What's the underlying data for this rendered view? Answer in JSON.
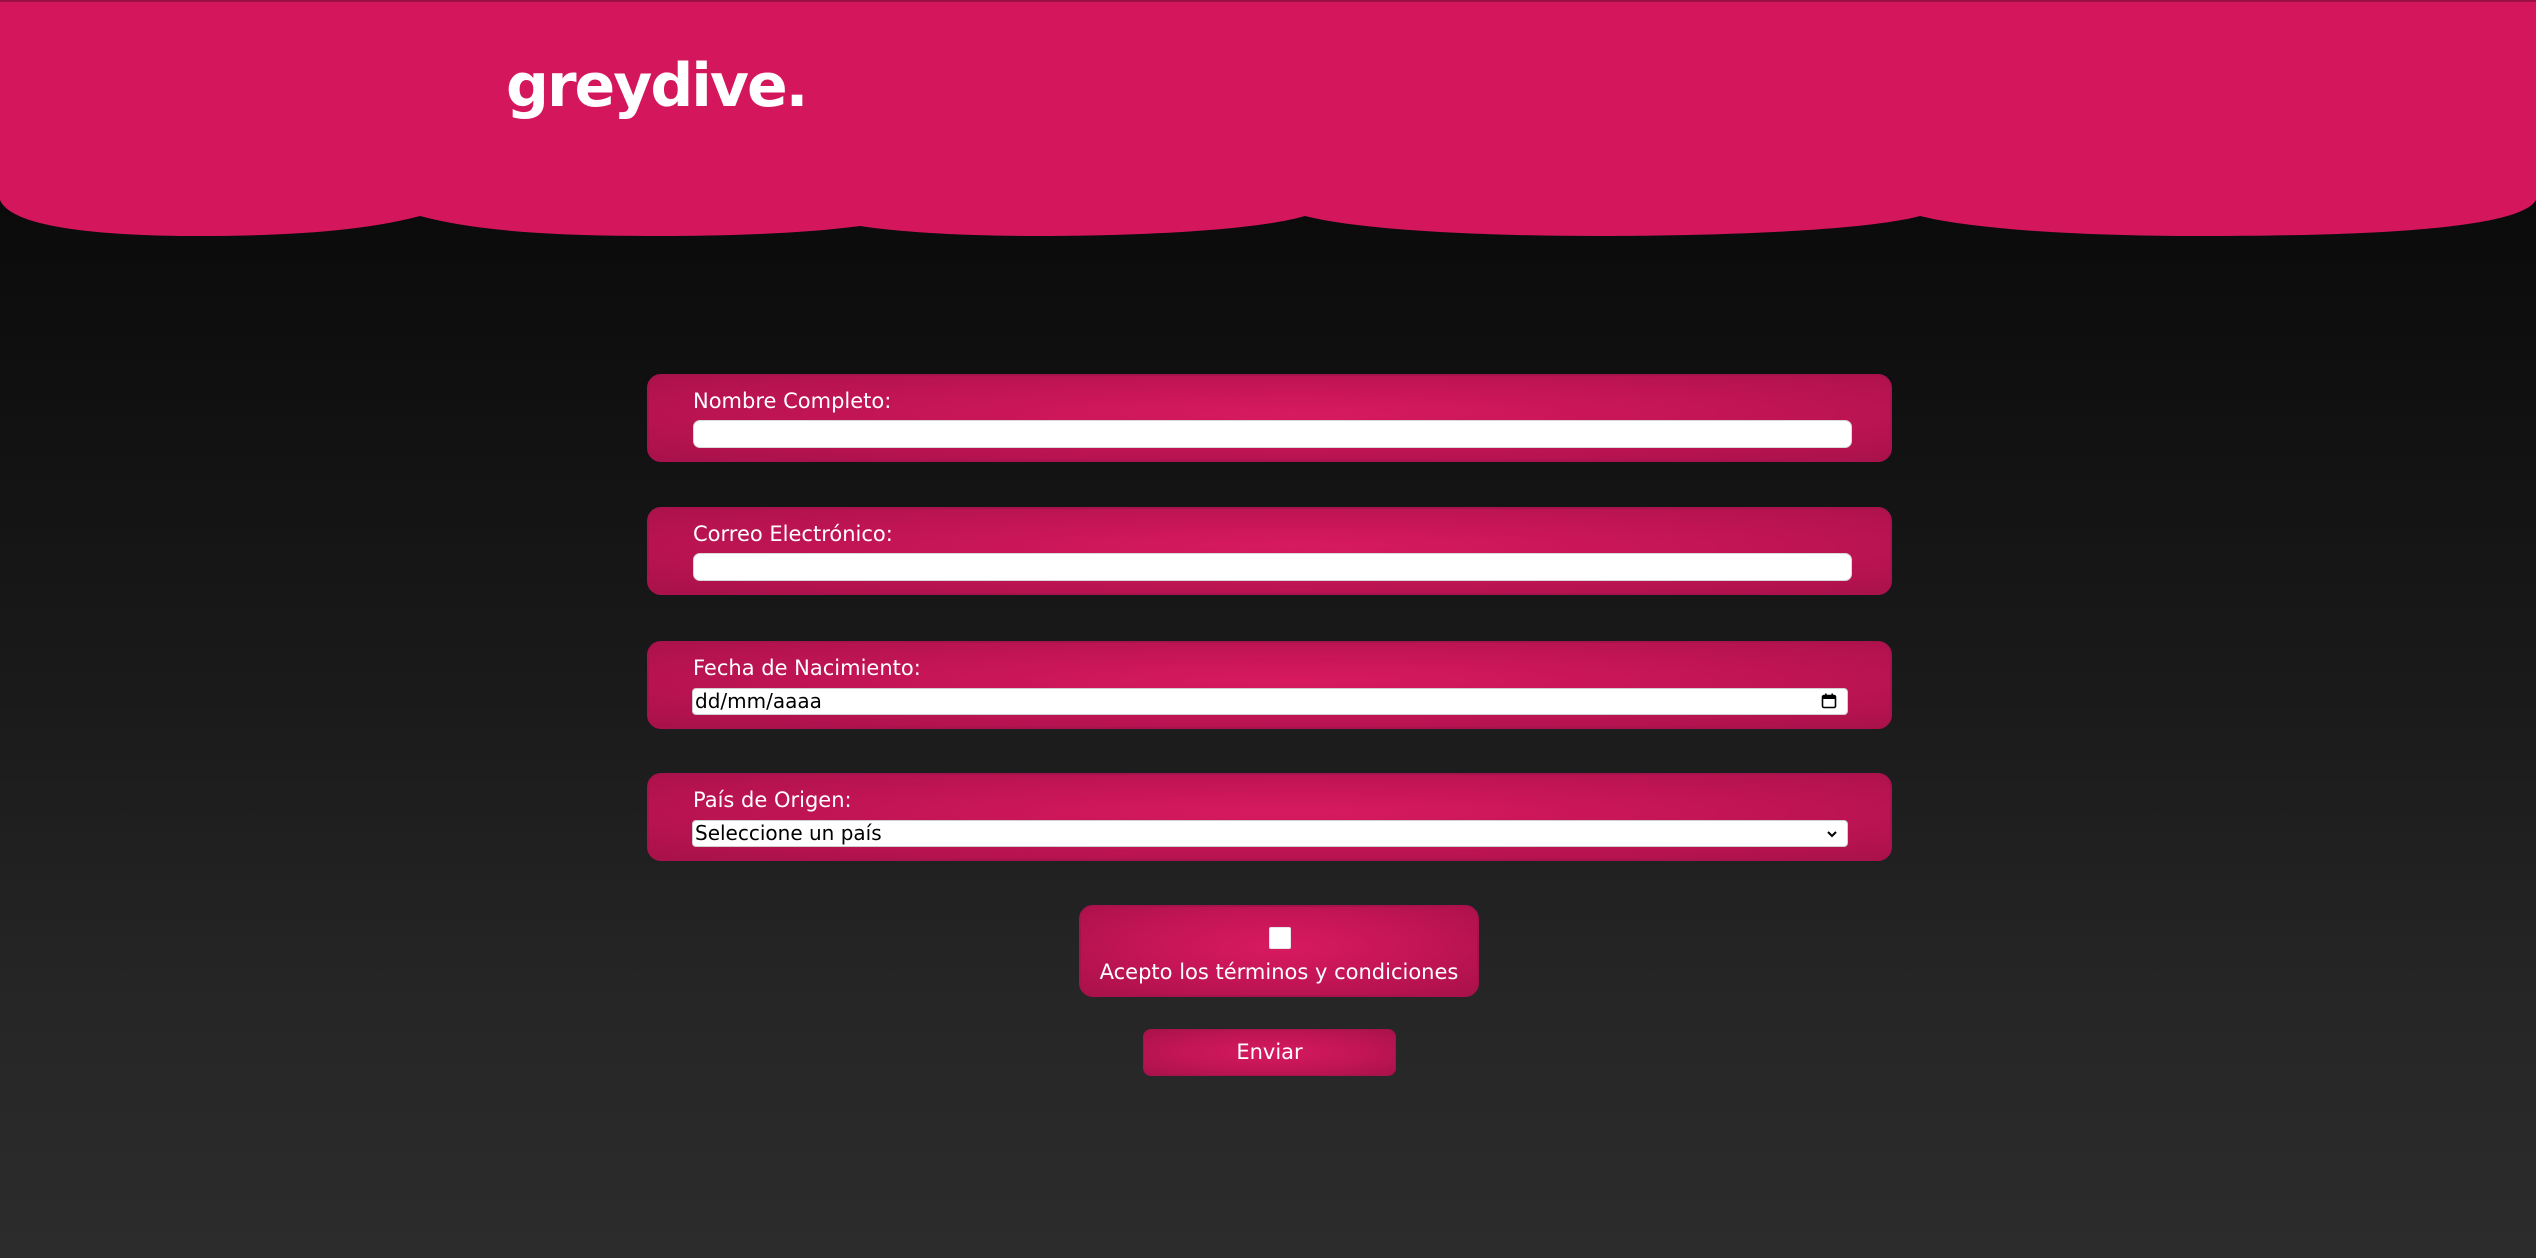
{
  "brand": {
    "logo_text": "greydive.",
    "accent_color": "#d4175c"
  },
  "form": {
    "fields": [
      {
        "label": "Nombre Completo:",
        "type": "text",
        "value": ""
      },
      {
        "label": "Correo Electrónico:",
        "type": "email",
        "value": ""
      },
      {
        "label": "Fecha de Nacimiento:",
        "type": "date",
        "value": "dd/mm/aaaa",
        "icon": "calendar-icon"
      },
      {
        "label": "País de Origen:",
        "type": "select",
        "value": "Seleccione un país",
        "icon": "chevron-down-icon"
      }
    ],
    "terms": {
      "label": "Acepto los términos y condiciones",
      "checked": false
    },
    "submit_label": "Enviar"
  }
}
